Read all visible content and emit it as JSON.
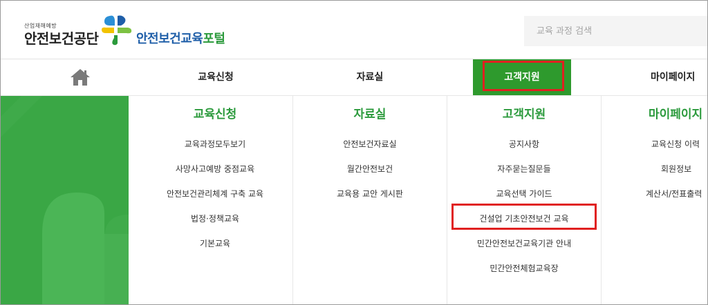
{
  "header": {
    "org_small": "산업재해예방",
    "org_name": "안전보건공단",
    "portal_main": "안전보건교육",
    "portal_accent": "포털",
    "search_placeholder": "교육 과정 검색"
  },
  "nav": {
    "home_icon": "home-icon",
    "items": [
      "교육신청",
      "자료실",
      "고객지원",
      "마이페이지"
    ],
    "active_index": 2
  },
  "menu": {
    "columns": [
      {
        "title": "교육신청",
        "links": [
          "교육과정모두보기",
          "사망사고예방 중점교육",
          "안전보건관리체계 구축 교육",
          "법정·정책교육",
          "기본교육"
        ]
      },
      {
        "title": "자료실",
        "links": [
          "안전보건자료실",
          "월간안전보건",
          "교육용 교안 게시판"
        ]
      },
      {
        "title": "고객지원",
        "links": [
          "공지사항",
          "자주묻는질문들",
          "교육선택 가이드",
          "건설업 기초안전보건 교육",
          "민간안전보건교육기관 안내",
          "민간안전체험교육장"
        ]
      },
      {
        "title": "마이페이지",
        "links": [
          "교육신청 이력",
          "회원정보",
          "계산서/전표출력"
        ]
      }
    ]
  },
  "colors": {
    "brand_green": "#2e9a2d",
    "panel_green": "#3aa745",
    "portal_blue": "#1e5ea8",
    "highlight_red": "#e02020"
  }
}
